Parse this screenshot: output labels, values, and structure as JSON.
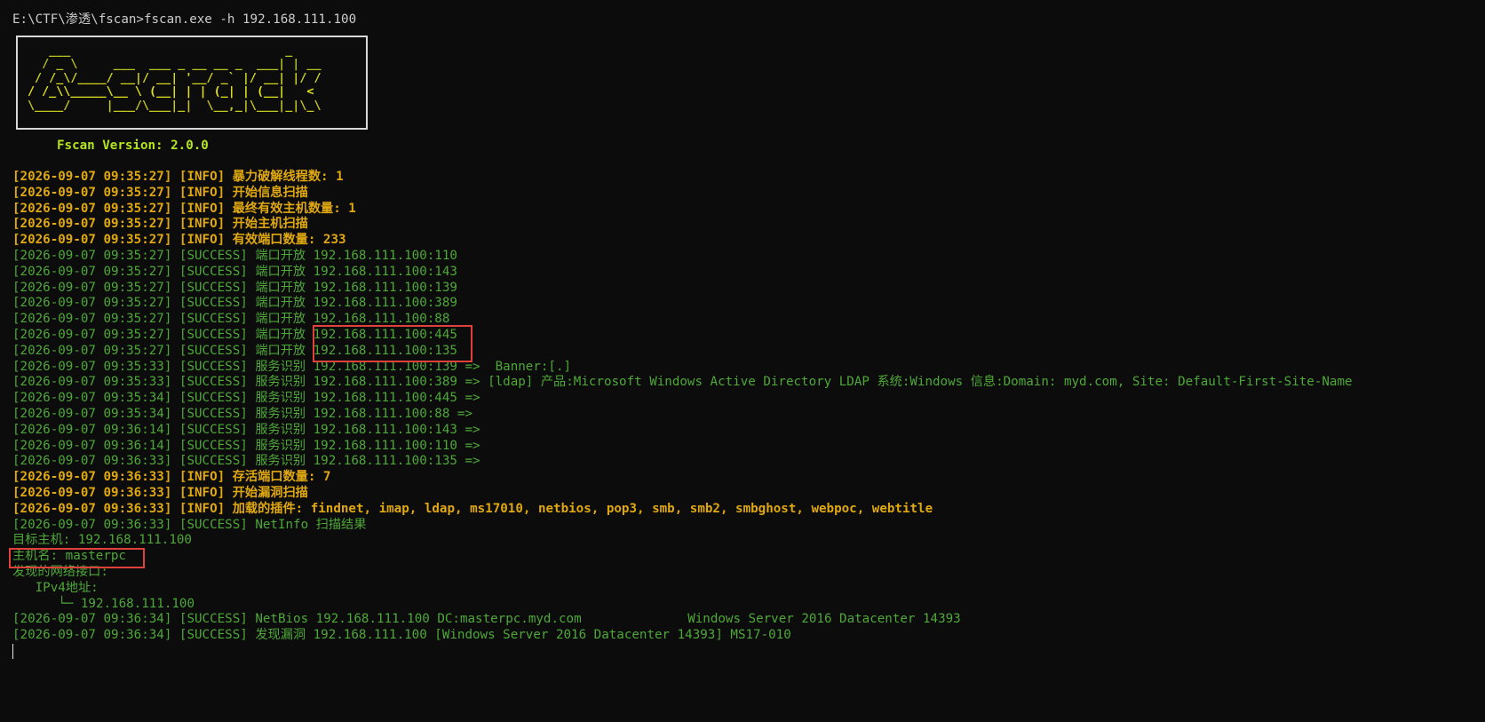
{
  "command": "E:\\CTF\\渗透\\fscan>fscan.exe -h 192.168.111.100",
  "banner": {
    "lines": [
      "   ___                              _",
      "  / _ \\     ___  ___ _ __ __ _  ___| | __",
      " / /_\\/____/ __|/ __| '__/ _` |/ __| |/ /",
      "/ /_\\\\_____\\__ \\ (__| | | (_| | (__|   <",
      "\\____/     |___/\\___|_|  \\__,_|\\___|_|\\_\\"
    ]
  },
  "version": "Fscan Version: 2.0.0",
  "log": [
    {
      "type": "info",
      "text": "[2026-09-07 09:35:27] [INFO] 暴力破解线程数: 1"
    },
    {
      "type": "info",
      "text": "[2026-09-07 09:35:27] [INFO] 开始信息扫描"
    },
    {
      "type": "info",
      "text": "[2026-09-07 09:35:27] [INFO] 最终有效主机数量: 1"
    },
    {
      "type": "info",
      "text": "[2026-09-07 09:35:27] [INFO] 开始主机扫描"
    },
    {
      "type": "info",
      "text": "[2026-09-07 09:35:27] [INFO] 有效端口数量: 233"
    },
    {
      "type": "success",
      "text": "[2026-09-07 09:35:27] [SUCCESS] 端口开放 192.168.111.100:110"
    },
    {
      "type": "success",
      "text": "[2026-09-07 09:35:27] [SUCCESS] 端口开放 192.168.111.100:143"
    },
    {
      "type": "success",
      "text": "[2026-09-07 09:35:27] [SUCCESS] 端口开放 192.168.111.100:139"
    },
    {
      "type": "success",
      "text": "[2026-09-07 09:35:27] [SUCCESS] 端口开放 192.168.111.100:389"
    },
    {
      "type": "success",
      "text": "[2026-09-07 09:35:27] [SUCCESS] 端口开放 192.168.111.100:88"
    },
    {
      "type": "success",
      "text": "[2026-09-07 09:35:27] [SUCCESS] 端口开放 192.168.111.100:445"
    },
    {
      "type": "success",
      "text": "[2026-09-07 09:35:27] [SUCCESS] 端口开放 192.168.111.100:135"
    },
    {
      "type": "success",
      "text": "[2026-09-07 09:35:33] [SUCCESS] 服务识别 192.168.111.100:139 =>  Banner:[.]"
    },
    {
      "type": "success",
      "text": "[2026-09-07 09:35:33] [SUCCESS] 服务识别 192.168.111.100:389 => [ldap] 产品:Microsoft Windows Active Directory LDAP 系统:Windows 信息:Domain: myd.com, Site: Default-First-Site-Name"
    },
    {
      "type": "success",
      "text": "[2026-09-07 09:35:34] [SUCCESS] 服务识别 192.168.111.100:445 =>"
    },
    {
      "type": "success",
      "text": "[2026-09-07 09:35:34] [SUCCESS] 服务识别 192.168.111.100:88 =>"
    },
    {
      "type": "success",
      "text": "[2026-09-07 09:36:14] [SUCCESS] 服务识别 192.168.111.100:143 =>"
    },
    {
      "type": "success",
      "text": "[2026-09-07 09:36:14] [SUCCESS] 服务识别 192.168.111.100:110 =>"
    },
    {
      "type": "success",
      "text": "[2026-09-07 09:36:33] [SUCCESS] 服务识别 192.168.111.100:135 =>"
    },
    {
      "type": "info",
      "text": "[2026-09-07 09:36:33] [INFO] 存活端口数量: 7"
    },
    {
      "type": "info",
      "text": "[2026-09-07 09:36:33] [INFO] 开始漏洞扫描"
    },
    {
      "type": "info",
      "text": "[2026-09-07 09:36:33] [INFO] 加载的插件: findnet, imap, ldap, ms17010, netbios, pop3, smb, smb2, smbghost, webpoc, webtitle"
    },
    {
      "type": "success",
      "text": "[2026-09-07 09:36:33] [SUCCESS] NetInfo 扫描结果"
    },
    {
      "type": "plain",
      "text": "目标主机: 192.168.111.100"
    },
    {
      "type": "plain",
      "text": "主机名: masterpc"
    },
    {
      "type": "plain",
      "text": "发现的网络接口:"
    },
    {
      "type": "plain",
      "text": "   IPv4地址:"
    },
    {
      "type": "plain",
      "text": "      └─ 192.168.111.100"
    },
    {
      "type": "success",
      "text": "[2026-09-07 09:36:34] [SUCCESS] NetBios 192.168.111.100 DC:masterpc.myd.com              Windows Server 2016 Datacenter 14393"
    },
    {
      "type": "success",
      "text": "[2026-09-07 09:36:34] [SUCCESS] 发现漏洞 192.168.111.100 [Windows Server 2016 Datacenter 14393] MS17-010"
    }
  ],
  "colors": {
    "background": "#0c0c0c",
    "info": "#e0a810",
    "success": "#4ea838",
    "highlight_box": "#e0413a"
  }
}
